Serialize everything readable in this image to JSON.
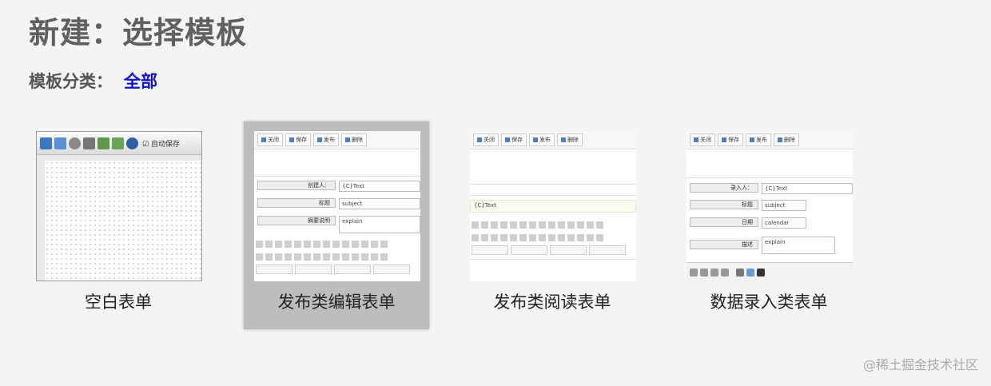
{
  "page": {
    "title": "新建：选择模板",
    "category_label": "模板分类：",
    "category_value": "全部"
  },
  "templates": [
    {
      "label": "空白表单",
      "selected": false,
      "thumb_checkbox": "自动保存"
    },
    {
      "label": "发布类编辑表单",
      "selected": true,
      "thumb_buttons": [
        "关闭",
        "保存",
        "发布",
        "删除"
      ],
      "thumb_fields": [
        {
          "label": "创建人：",
          "value": "{C}Text"
        },
        {
          "label": "标题",
          "value": "subject"
        },
        {
          "label": "摘要说明",
          "value": "explain"
        }
      ]
    },
    {
      "label": "发布类阅读表单",
      "selected": false,
      "thumb_buttons": [
        "关闭",
        "保存",
        "发布",
        "删除"
      ],
      "thumb_text": "{C}Text"
    },
    {
      "label": "数据录入类表单",
      "selected": false,
      "thumb_buttons": [
        "关闭",
        "保存",
        "发布",
        "删除"
      ],
      "thumb_fields": [
        {
          "label": "录入人：",
          "value": "{C}Text"
        },
        {
          "label": "标题",
          "value": "subject"
        },
        {
          "label": "日期",
          "value": "calendar"
        },
        {
          "label": "描述",
          "value": "explain"
        }
      ]
    }
  ],
  "watermark": "@稀土掘金技术社区",
  "colors": {
    "accent": "#1010d0",
    "selected_bg": "#bdbdbd",
    "page_bg": "#f4f4f4"
  }
}
